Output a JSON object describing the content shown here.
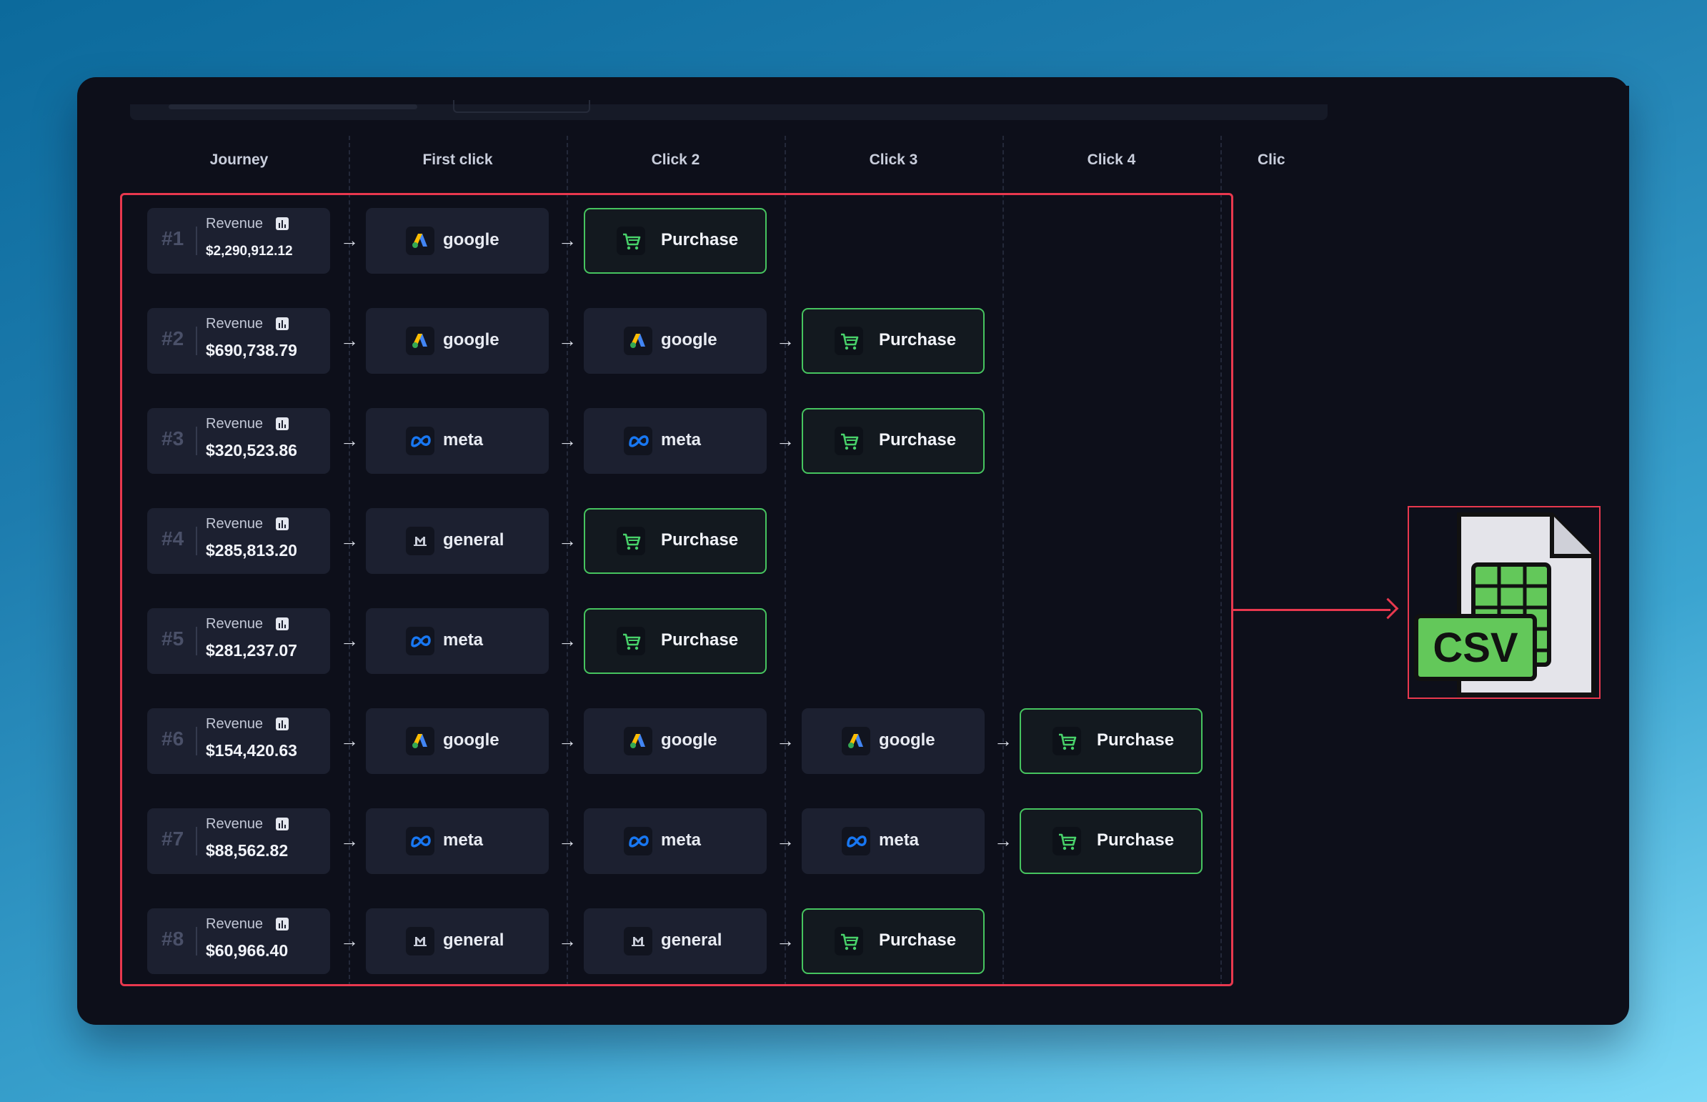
{
  "columns": [
    "Journey",
    "First click",
    "Click 2",
    "Click 3",
    "Click 4",
    "Clic"
  ],
  "revenue_label": "Revenue",
  "icons": {
    "google": "google-ads-icon",
    "meta": "meta-icon",
    "general": "general-channel-icon",
    "purchase": "cart-icon",
    "revenue_chart": "bar-chart-icon"
  },
  "colors": {
    "highlight": "#e8384e",
    "purchase_border": "#46c45f",
    "meta_blue": "#1877f2"
  },
  "journeys": [
    {
      "num": "#1",
      "revenue": "$2,290,912.12",
      "steps": [
        "google",
        "Purchase"
      ]
    },
    {
      "num": "#2",
      "revenue": "$690,738.79",
      "steps": [
        "google",
        "google",
        "Purchase"
      ]
    },
    {
      "num": "#3",
      "revenue": "$320,523.86",
      "steps": [
        "meta",
        "meta",
        "Purchase"
      ]
    },
    {
      "num": "#4",
      "revenue": "$285,813.20",
      "steps": [
        "general",
        "Purchase"
      ]
    },
    {
      "num": "#5",
      "revenue": "$281,237.07",
      "steps": [
        "meta",
        "Purchase"
      ]
    },
    {
      "num": "#6",
      "revenue": "$154,420.63",
      "steps": [
        "google",
        "google",
        "google",
        "Purchase"
      ]
    },
    {
      "num": "#7",
      "revenue": "$88,562.82",
      "steps": [
        "meta",
        "meta",
        "meta",
        "Purchase"
      ]
    },
    {
      "num": "#8",
      "revenue": "$60,966.40",
      "steps": [
        "general",
        "general",
        "Purchase"
      ]
    }
  ],
  "csv": {
    "label": "CSV",
    "icon": "csv-file-icon"
  }
}
